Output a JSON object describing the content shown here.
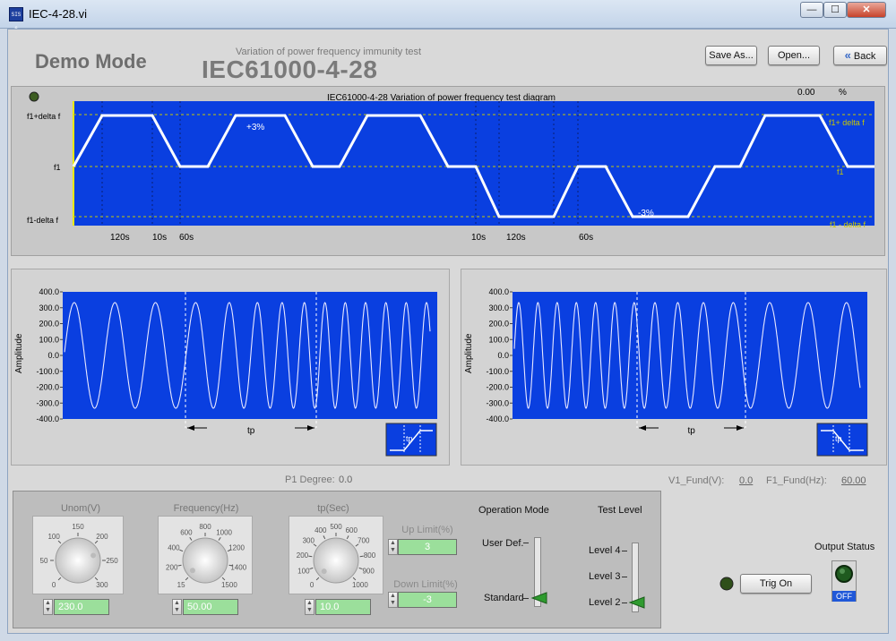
{
  "window": {
    "title": "IEC-4-28.vi",
    "app_icon_text": "SIS 6",
    "minimize": "—",
    "maximize": "☐",
    "close": "✕"
  },
  "header": {
    "mode_label": "Demo Mode",
    "subtitle": "Variation of power frequency immunity test",
    "title": "IEC61000-4-28",
    "save_as": "Save As...",
    "open": "Open...",
    "back": "Back",
    "back_icon": "double-chevron-left"
  },
  "diagram": {
    "title": "IEC61000-4-28 Variation of power frequency test diagram",
    "percent_value": "0.00",
    "percent_unit": "%",
    "y_labels": [
      "f1+delta f",
      "f1",
      "f1-delta f"
    ],
    "right_labels": [
      "f1+ delta f",
      "f1",
      "f1 - delta f"
    ],
    "annot_plus": "+3%",
    "annot_minus": "-3%",
    "time_labels": [
      "120s",
      "10s",
      "60s",
      "10s",
      "120s",
      "60s"
    ],
    "colors": {
      "plot_bg": "#0a3fe0",
      "trace": "#ffffff",
      "grid": "#c8c800"
    }
  },
  "waveform_left": {
    "ylabel": "Amplitude",
    "yticks": [
      "400.0",
      "300.0",
      "200.0",
      "100.0",
      "0.0",
      "-100.0",
      "-200.0",
      "-300.0",
      "-400.0"
    ],
    "tp_label": "tp",
    "inset_label": "tp"
  },
  "waveform_right": {
    "ylabel": "Amplitude",
    "yticks": [
      "400.0",
      "300.0",
      "200.0",
      "100.0",
      "0.0",
      "-100.0",
      "-200.0",
      "-300.0",
      "-400.0"
    ],
    "tp_label": "tp",
    "inset_label": "tp"
  },
  "readouts": {
    "p1_degree_label": "P1 Degree:",
    "p1_degree_value": "0.0",
    "v1_fund_label": "V1_Fund(V):",
    "v1_fund_value": "0.0",
    "f1_fund_label": "F1_Fund(Hz):",
    "f1_fund_value": "60.00"
  },
  "controls": {
    "unom": {
      "label": "Unom(V)",
      "scale": [
        "0",
        "50",
        "100",
        "150",
        "200",
        "250",
        "300"
      ],
      "value": "230.0"
    },
    "frequency": {
      "label": "Frequency(Hz)",
      "scale": [
        "15",
        "200",
        "400",
        "600",
        "800",
        "1000",
        "1200",
        "1400",
        "1500"
      ],
      "value": "50.00"
    },
    "tp": {
      "label": "tp(Sec)",
      "scale": [
        "0",
        "100",
        "200",
        "300",
        "400",
        "500",
        "600",
        "700",
        "800",
        "900",
        "1000"
      ],
      "value": "10.0"
    },
    "up_limit": {
      "label": "Up Limit(%)",
      "value": "3"
    },
    "down_limit": {
      "label": "Down Limit(%)",
      "value": "-3"
    },
    "operation_mode": {
      "label": "Operation Mode",
      "options": [
        "User Def.",
        "Standard"
      ],
      "selected": "Standard"
    },
    "test_level": {
      "label": "Test Level",
      "options": [
        "Level 4",
        "Level 3",
        "Level 2"
      ],
      "selected": "Level 2"
    }
  },
  "output": {
    "trig_button": "Trig On",
    "status_label": "Output Status",
    "status_value": "OFF"
  }
}
